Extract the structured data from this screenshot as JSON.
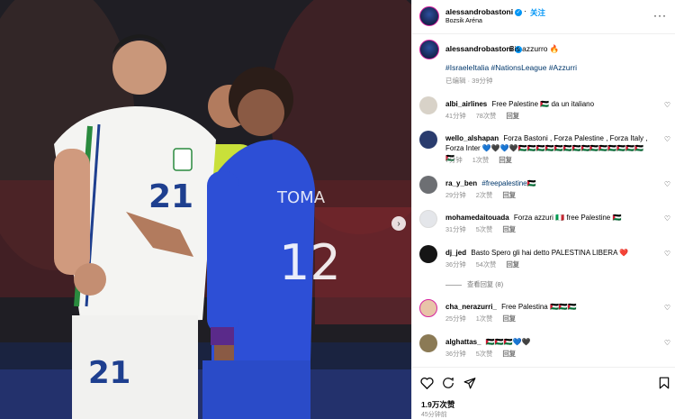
{
  "post": {
    "username": "alessandrobastoni",
    "follow_label": "关注",
    "location": "Bozsik Aréna",
    "caption": "Bis azzurro",
    "caption_emoji": "🔥",
    "hashtags": "#IsraeleItalia #NationsLeague #Azzurri",
    "edited": "已编辑 · 39分钟",
    "likes": "1.9万次赞",
    "time_ago": "45分钟前"
  },
  "photo": {
    "jersey_left_number": "21",
    "jersey_left_shorts_number": "21",
    "jersey_right_number": "12",
    "jersey_right_name": "TOMA"
  },
  "comments": [
    {
      "username": "albi_airlines",
      "text": "Free Palestine 🇵🇸 da un italiano",
      "time": "41分钟",
      "likes": "78次赞",
      "reply": "回复",
      "avatar_color": "#d8d2c8"
    },
    {
      "username": "wello_alshapan",
      "text": "Forza Bastoni , Forza Palestine , Forza Italy , Forza Inter 💙🖤💙🖤🇵🇸🇵🇸🇵🇸🇵🇸🇵🇸🇵🇸🇵🇸🇵🇸🇵🇸🇵🇸🇵🇸🇵🇸🇵🇸🇵🇸🇵🇸",
      "time": "7分钟",
      "likes": "1次赞",
      "reply": "回复",
      "avatar_color": "#2a3c6e"
    },
    {
      "username": "ra_y_ben",
      "text": "#freepalestine🇵🇸",
      "time": "29分钟",
      "likes": "2次赞",
      "reply": "回复",
      "avatar_color": "#6d6f73"
    },
    {
      "username": "mohamedaitouada",
      "text": "Forza azzuri 🇮🇹 free Palestine 🇵🇸",
      "time": "31分钟",
      "likes": "5次赞",
      "reply": "回复",
      "avatar_color": "#e4e6ea"
    },
    {
      "username": "dj_jed",
      "text": "Basto Spero gli hai detto PALESTINA LIBERA ❤️",
      "time": "36分钟",
      "likes": "54次赞",
      "reply": "回复",
      "avatar_color": "#151515"
    },
    {
      "username": "cha_nerazurri_",
      "text": "Free Palestina 🇵🇸🇵🇸🇵🇸",
      "time": "25分钟",
      "likes": "1次赞",
      "reply": "回复",
      "avatar_color": "#e8c4a8"
    },
    {
      "username": "alghattas_",
      "text": "🇵🇸🇵🇸🇵🇸💙🖤",
      "time": "36分钟",
      "likes": "5次赞",
      "reply": "回复",
      "avatar_color": "#8b7a55"
    }
  ],
  "view_replies": "查看回复 (8)",
  "icons": {
    "verified": "verified-badge-icon",
    "more": "more-options-icon",
    "heart": "heart-icon",
    "comment": "comment-icon",
    "share": "share-icon",
    "save": "bookmark-icon",
    "next": "chevron-right-icon"
  },
  "colors": {
    "link": "#0095f6",
    "hashtag": "#00376b",
    "muted": "#8e8e8e"
  }
}
